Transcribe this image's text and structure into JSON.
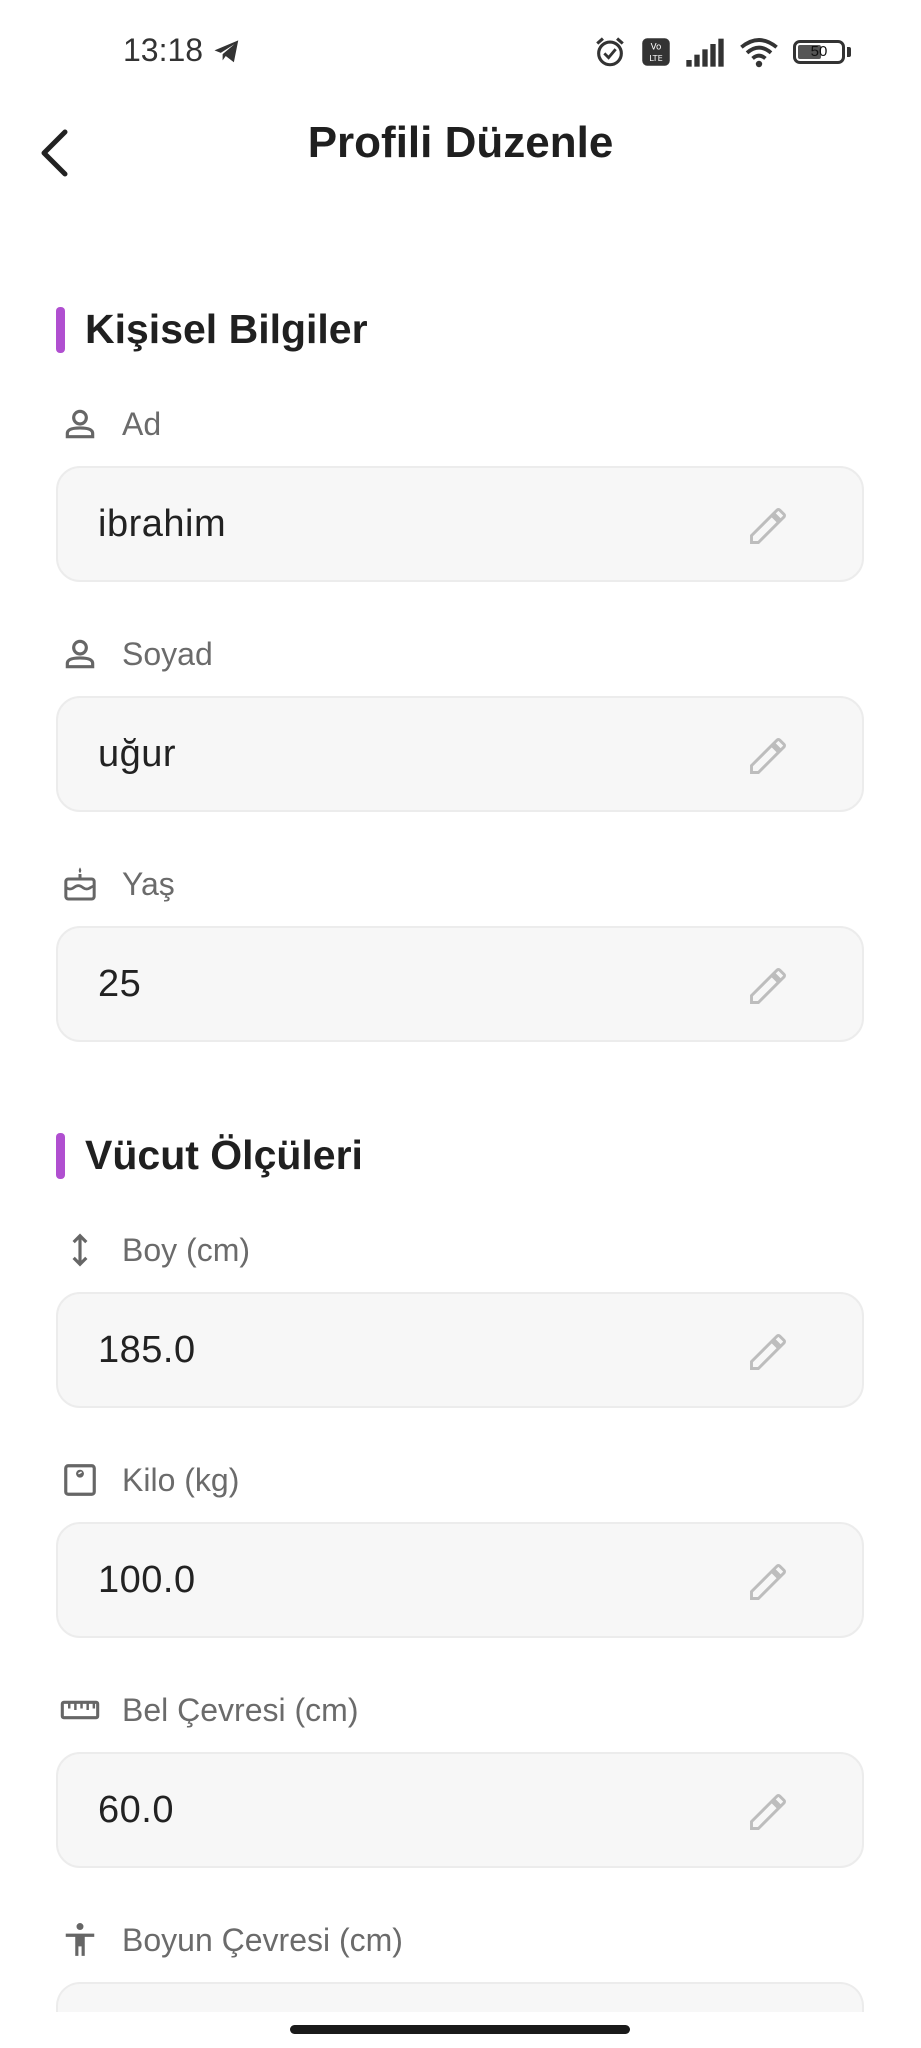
{
  "status_bar": {
    "time": "13:18",
    "battery_level": "50",
    "icons": [
      "telegram-icon",
      "alarm-icon",
      "volte-icon",
      "signal-icon",
      "wifi-icon",
      "battery-icon"
    ]
  },
  "app_bar": {
    "title": "Profili Düzenle",
    "back_icon": "chevron-left-icon"
  },
  "sections": {
    "personal": {
      "title": "Kişisel Bilgiler"
    },
    "body": {
      "title": "Vücut Ölçüleri"
    }
  },
  "fields": {
    "first_name": {
      "label": "Ad",
      "value": "ibrahim",
      "icon": "person-icon"
    },
    "last_name": {
      "label": "Soyad",
      "value": "uğur",
      "icon": "person-icon"
    },
    "age": {
      "label": "Yaş",
      "value": "25",
      "icon": "cake-icon"
    },
    "height": {
      "label": "Boy (cm)",
      "value": "185.0",
      "icon": "height-icon"
    },
    "weight": {
      "label": "Kilo (kg)",
      "value": "100.0",
      "icon": "scale-icon"
    },
    "waist": {
      "label": "Bel Çevresi (cm)",
      "value": "60.0",
      "icon": "ruler-icon"
    },
    "neck": {
      "label": "Boyun Çevresi (cm)",
      "value": "",
      "icon": "accessibility-icon"
    }
  },
  "colors": {
    "accent": "#b04fd0",
    "field_background": "#f7f7f7",
    "label": "#6b6b6b"
  }
}
